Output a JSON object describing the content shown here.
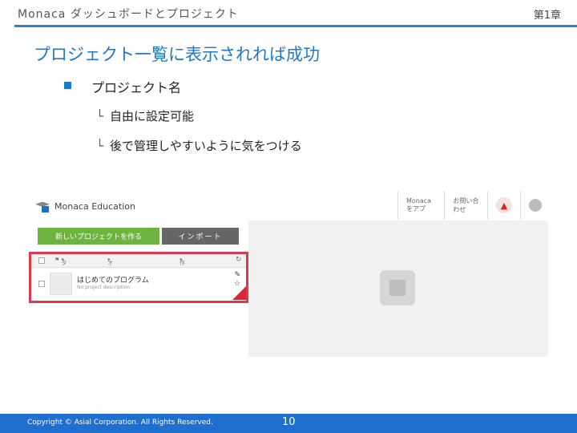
{
  "header": {
    "left": "Monaca ダッシュボードとプロジェクト",
    "right": "第1章"
  },
  "slide": {
    "title": "プロジェクト一覧に表示されれば成功",
    "bullet": "プロジェクト名",
    "subs": [
      "自由に設定可能",
      "後で管理しやすいように気をつける"
    ],
    "sub_marker": "└"
  },
  "screenshot": {
    "brand": "Monaca Education",
    "topbar": {
      "about": "Monacaをアプ",
      "contact": "お問い合わせ"
    },
    "buttons": {
      "new_project": "新しいプロジェクトを作る",
      "import": "インポート"
    },
    "filter": {
      "tag": "タグ",
      "online": "オンライン",
      "sort": "作成日順"
    },
    "project": {
      "name": "はじめてのプログラム",
      "description": "No project description"
    },
    "colors": {
      "green": "#6db33f",
      "highlight": "#e0374f",
      "ribbon": "#d8263a"
    }
  },
  "footer": {
    "copyright": "Copyright © Asial Corporation. All Rights Reserved.",
    "page": "10"
  },
  "colors": {
    "accent": "#1f77c9",
    "footer": "#1f6fd0"
  }
}
